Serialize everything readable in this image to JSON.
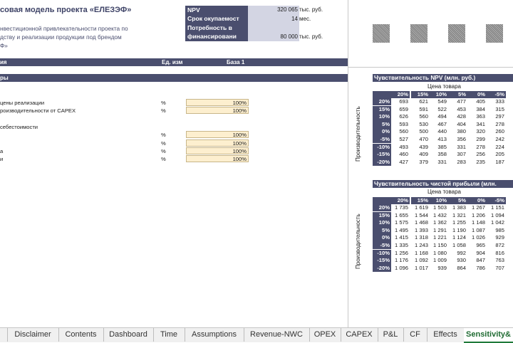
{
  "header": {
    "title": "совая модель проекта «ЕЛЕЗЭФ»",
    "description_lines": [
      "нвестиционной привлекательности проекта по",
      "дству и реализации продукции под брендом",
      "Ф»"
    ]
  },
  "kpi": [
    {
      "label": "NPV",
      "value": "320 065",
      "unit": "тыс. руб."
    },
    {
      "label": "Срок окупаемост",
      "value": "14",
      "unit": "мес."
    },
    {
      "label": "Потребность в",
      "value": "",
      "unit": ""
    },
    {
      "label": "финансировани",
      "value": "80 000",
      "unit": "тыс. руб."
    }
  ],
  "table_header": {
    "col1": "ия",
    "col2": "Ед. изм",
    "col3": "База 1"
  },
  "section_band": {
    "label": "ры"
  },
  "rows": [
    {
      "label": "цены реализации",
      "unit": "%",
      "value": "100%"
    },
    {
      "label": "роизводительности от CAPEX",
      "unit": "%",
      "value": "100%"
    },
    {
      "label": "себестоимости",
      "unit": "",
      "value": ""
    },
    {
      "label": "",
      "unit": "%",
      "value": "100%"
    },
    {
      "label": "",
      "unit": "%",
      "value": "100%"
    },
    {
      "label": "а",
      "unit": "%",
      "value": "100%"
    },
    {
      "label": "и",
      "unit": "%",
      "value": "100%"
    }
  ],
  "sensitivity_npv": {
    "title": "Чувствительность NPV (млн. руб.)",
    "col_axis": "Цена товара",
    "row_axis": "Производительность",
    "columns": [
      "20%",
      "15%",
      "10%",
      "5%",
      "0%",
      "-5%"
    ],
    "rows": [
      {
        "label": "20%",
        "values": [
          "693",
          "621",
          "549",
          "477",
          "405",
          "333"
        ]
      },
      {
        "label": "15%",
        "values": [
          "659",
          "591",
          "522",
          "453",
          "384",
          "315"
        ]
      },
      {
        "label": "10%",
        "values": [
          "626",
          "560",
          "494",
          "428",
          "363",
          "297"
        ]
      },
      {
        "label": "5%",
        "values": [
          "593",
          "530",
          "467",
          "404",
          "341",
          "278"
        ]
      },
      {
        "label": "0%",
        "values": [
          "560",
          "500",
          "440",
          "380",
          "320",
          "260"
        ]
      },
      {
        "label": "-5%",
        "values": [
          "527",
          "470",
          "413",
          "356",
          "299",
          "242"
        ]
      },
      {
        "label": "-10%",
        "values": [
          "493",
          "439",
          "385",
          "331",
          "278",
          "224"
        ]
      },
      {
        "label": "-15%",
        "values": [
          "460",
          "409",
          "358",
          "307",
          "256",
          "205"
        ]
      },
      {
        "label": "-20%",
        "values": [
          "427",
          "379",
          "331",
          "283",
          "235",
          "187"
        ]
      }
    ]
  },
  "sensitivity_profit": {
    "title": "Чувствительность чистой прибыли (млн.",
    "col_axis": "Цена товара",
    "row_axis": "Производительность",
    "columns": [
      "20%",
      "15%",
      "10%",
      "5%",
      "0%",
      "-5%"
    ],
    "rows": [
      {
        "label": "20%",
        "values": [
          "1 735",
          "1 619",
          "1 503",
          "1 383",
          "1 267",
          "1 151"
        ]
      },
      {
        "label": "15%",
        "values": [
          "1 655",
          "1 544",
          "1 432",
          "1 321",
          "1 206",
          "1 094"
        ]
      },
      {
        "label": "10%",
        "values": [
          "1 575",
          "1 468",
          "1 362",
          "1 255",
          "1 148",
          "1 042"
        ]
      },
      {
        "label": "5%",
        "values": [
          "1 495",
          "1 393",
          "1 291",
          "1 190",
          "1 087",
          "985"
        ]
      },
      {
        "label": "0%",
        "values": [
          "1 415",
          "1 318",
          "1 221",
          "1 124",
          "1 026",
          "929"
        ]
      },
      {
        "label": "-5%",
        "values": [
          "1 335",
          "1 243",
          "1 150",
          "1 058",
          "965",
          "872"
        ]
      },
      {
        "label": "-10%",
        "values": [
          "1 256",
          "1 168",
          "1 080",
          "992",
          "904",
          "816"
        ]
      },
      {
        "label": "-15%",
        "values": [
          "1 176",
          "1 092",
          "1 009",
          "930",
          "847",
          "763"
        ]
      },
      {
        "label": "-20%",
        "values": [
          "1 096",
          "1 017",
          "939",
          "864",
          "786",
          "707"
        ]
      }
    ]
  },
  "tabs": [
    {
      "label": ""
    },
    {
      "label": "Disclaimer"
    },
    {
      "label": "Contents"
    },
    {
      "label": "Dashboard"
    },
    {
      "label": "Time"
    },
    {
      "label": "Assumptions"
    },
    {
      "label": "Revenue-NWC"
    },
    {
      "label": "OPEX"
    },
    {
      "label": "CAPEX"
    },
    {
      "label": "P&L"
    },
    {
      "label": "CF"
    },
    {
      "label": "Effects"
    },
    {
      "label": "Sensitivity&"
    }
  ],
  "colors": {
    "band": "#4a4e6e",
    "input": "#fdefcf",
    "kpi_value": "#d3d5e3",
    "active_tab": "#1f6b32"
  }
}
